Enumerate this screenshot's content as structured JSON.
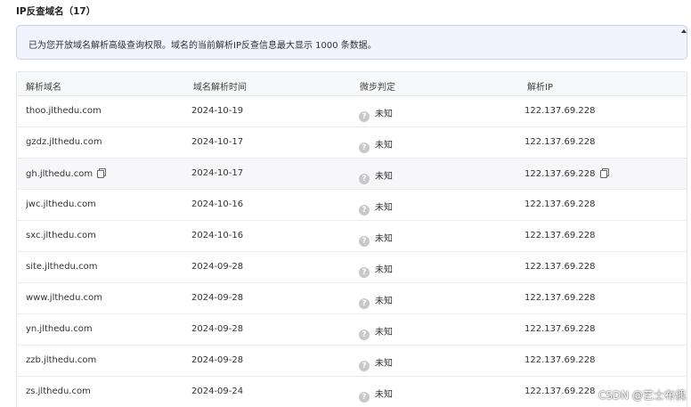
{
  "page": {
    "title": "IP反查域名（17）",
    "notice": "已为您开放域名解析高级查询权限。域名的当前解析IP反查信息最大显示 1000 条数据。"
  },
  "table": {
    "headers": [
      "解析域名",
      "域名解析时间",
      "微步判定",
      "解析IP"
    ],
    "rows": [
      {
        "domain": "thoo.jlthedu.com",
        "time": "2024-10-19",
        "verdict": "未知",
        "ip": "122.137.69.228"
      },
      {
        "domain": "gzdz.jlthedu.com",
        "time": "2024-10-17",
        "verdict": "未知",
        "ip": "122.137.69.228"
      },
      {
        "domain": "gh.jlthedu.com",
        "time": "2024-10-17",
        "verdict": "未知",
        "ip": "122.137.69.228"
      },
      {
        "domain": "jwc.jlthedu.com",
        "time": "2024-10-16",
        "verdict": "未知",
        "ip": "122.137.69.228"
      },
      {
        "domain": "sxc.jlthedu.com",
        "time": "2024-10-16",
        "verdict": "未知",
        "ip": "122.137.69.228"
      },
      {
        "domain": "site.jlthedu.com",
        "time": "2024-09-28",
        "verdict": "未知",
        "ip": "122.137.69.228"
      },
      {
        "domain": "www.jlthedu.com",
        "time": "2024-09-28",
        "verdict": "未知",
        "ip": "122.137.69.228"
      },
      {
        "domain": "yn.jlthedu.com",
        "time": "2024-09-28",
        "verdict": "未知",
        "ip": "122.137.69.228"
      },
      {
        "domain": "zzb.jlthedu.com",
        "time": "2024-09-28",
        "verdict": "未知",
        "ip": "122.137.69.228"
      },
      {
        "domain": "zs.jlthedu.com",
        "time": "2024-09-24",
        "verdict": "未知",
        "ip": "122.137.69.228"
      }
    ]
  },
  "icons": {
    "verdict_icon": "question-circle-icon",
    "copy_icon": "copy-icon"
  },
  "watermark": "CSDN @艺士布偶"
}
